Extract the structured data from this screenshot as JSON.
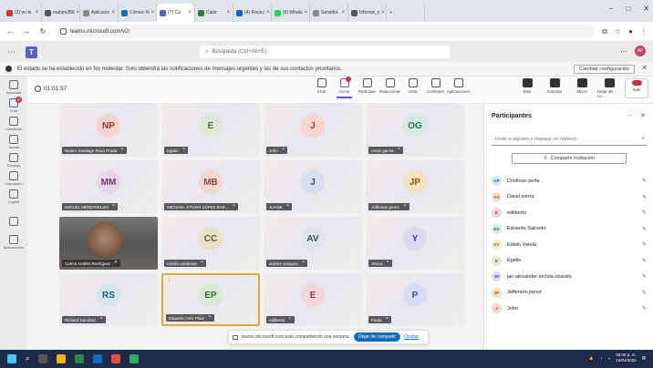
{
  "browser": {
    "tabs": [
      {
        "label": "(2) no le",
        "color": "#c23b22"
      },
      {
        "label": "mafam286",
        "color": "#555555"
      },
      {
        "label": "Aplicacio",
        "color": "#888888"
      },
      {
        "label": "Correo: N",
        "color": "#0f6cbd"
      },
      {
        "label": "(7) Ca",
        "color": "#5b5fc7",
        "active": true
      },
      {
        "label": "Calor",
        "color": "#2e7d32"
      },
      {
        "label": "(4) Rounc",
        "color": "#1565c0"
      },
      {
        "label": "(6) Whats",
        "color": "#25d366"
      },
      {
        "label": "Servidor",
        "color": "#888888"
      },
      {
        "label": "Informe_c",
        "color": "#555555"
      }
    ],
    "url": "teams.microsoft.com/v2/",
    "window_controls": [
      "−",
      "□",
      "✕"
    ]
  },
  "teams": {
    "search_placeholder": "Búsqueda (Ctrl+Alt+E)",
    "user_initials": "AF"
  },
  "banner": {
    "text": "El estado se ha establecido en No molestar. Solo obtendrá las notificaciones de mensajes urgentes y las de sus contactos prioritarios.",
    "button": "Cambiar configuración"
  },
  "rail": [
    {
      "label": "Actividad",
      "icon": "bell-icon"
    },
    {
      "label": "Chat",
      "icon": "chat-icon",
      "badge": "8",
      "active": true
    },
    {
      "label": "Llamadas",
      "icon": "phone-icon"
    },
    {
      "label": "Tareas",
      "icon": "tasks-icon"
    },
    {
      "label": "Equipos",
      "icon": "teams-icon"
    },
    {
      "label": "Calendario",
      "icon": "calendar-icon"
    },
    {
      "label": "Copilot",
      "icon": "copilot-icon"
    },
    {
      "label": "…",
      "icon": "more-icon"
    },
    {
      "label": "Aplicaciones",
      "icon": "apps-icon"
    }
  ],
  "meeting": {
    "timer": "01:01:57",
    "tools": [
      {
        "label": "Chat",
        "icon": "chat-icon"
      },
      {
        "label": "Gente",
        "icon": "people-icon",
        "active": true,
        "badge": true
      },
      {
        "label": "Participar",
        "icon": "raise-hand-icon"
      },
      {
        "label": "Reaccionar",
        "icon": "reaction-icon"
      },
      {
        "label": "Vista",
        "icon": "view-icon"
      },
      {
        "label": "Controles",
        "icon": "controls-icon"
      },
      {
        "label": "Aplicaciones",
        "icon": "apps-icon"
      }
    ],
    "tools2": [
      {
        "label": "Más",
        "icon": "more-icon"
      },
      {
        "label": "Cámara",
        "icon": "camera-off-icon"
      },
      {
        "label": "Micro",
        "icon": "mic-icon"
      },
      {
        "label": "Dejar de co...",
        "icon": "share-stop-icon"
      },
      {
        "label": "Salir",
        "icon": "leave-icon"
      }
    ]
  },
  "tiles": [
    {
      "initials": "NP",
      "name": "Nestor Santiago Rozo Prada",
      "color": "#f3d3cf",
      "fg": "#8b3a32"
    },
    {
      "initials": "E",
      "name": "Egidio",
      "color": "#dfe9d6",
      "fg": "#4a6b3a"
    },
    {
      "initials": "J",
      "name": "John",
      "color": "#f6d5cf",
      "fg": "#9b3d2f"
    },
    {
      "initials": "OG",
      "name": "oscar garcia",
      "color": "#d4ece4",
      "fg": "#2f6b58"
    },
    {
      "initials": "MM",
      "name": "MIGUEL MENDIVELSO",
      "color": "#ead6ea",
      "fg": "#6f3a6f"
    },
    {
      "initials": "MB",
      "name": "MICHAEL STIVEN LOPEZ BAR...",
      "color": "#f0d9d3",
      "fg": "#8a4a3a"
    },
    {
      "initials": "J",
      "name": "JUANK",
      "color": "#d9dff0",
      "fg": "#3a4a7a"
    },
    {
      "initials": "JP",
      "name": "Jefferson perez",
      "color": "#f3e2c4",
      "fg": "#8a5a1a"
    },
    {
      "initials": "",
      "name": "Carlos Andrés Rodríguez",
      "video": true
    },
    {
      "initials": "CC",
      "name": "camilo cardenas",
      "color": "#e6e2c8",
      "fg": "#6b5e2a"
    },
    {
      "initials": "AV",
      "name": "andres vasquez",
      "color": "#dfe4ea",
      "fg": "#3d4a5a"
    },
    {
      "initials": "Y",
      "name": "Yesca",
      "color": "#dcd8f0",
      "fg": "#4a3f8a"
    },
    {
      "initials": "RS",
      "name": "Richard Sanchez",
      "color": "#d2e6ec",
      "fg": "#2f5c6b"
    },
    {
      "initials": "EP",
      "name": "Eduardo Ortiz Páez",
      "color": "#d7ead4",
      "fg": "#3a6b33",
      "highlight": true,
      "reaction": "1"
    },
    {
      "initials": "E",
      "name": "edilberto",
      "color": "#f3d6dc",
      "fg": "#8a3a4a"
    },
    {
      "initials": "P",
      "name": "Paula",
      "color": "#d6dcf3",
      "fg": "#3a4a8a"
    }
  ],
  "share_bar": {
    "text": "teams.microsoft.com está compartiendo una ventana.",
    "stop": "Dejar de compartir",
    "hide": "Ocultar"
  },
  "panel": {
    "title": "Participantes",
    "invite_placeholder": "Invite a alguien o marque un número",
    "share_invite": "Compartir invitación",
    "participants": [
      {
        "initials": "CP",
        "name": "Cristhian peña",
        "color": "#d6e8f3",
        "fg": "#2a5a7a"
      },
      {
        "initials": "DS",
        "name": "David sierra",
        "color": "#f3e2d3",
        "fg": "#8a5a2a"
      },
      {
        "initials": "E",
        "name": "edilberto",
        "color": "#f3d6dc",
        "fg": "#8a3a4a"
      },
      {
        "initials": "ES",
        "name": "Eduardo Salcedo",
        "color": "#d6ece2",
        "fg": "#2f6b4a"
      },
      {
        "initials": "EV",
        "name": "Edwin Varela",
        "color": "#f3ecd3",
        "fg": "#7a6a2a"
      },
      {
        "initials": "E",
        "name": "Egidio",
        "color": "#dfe9d6",
        "fg": "#4a6b3a"
      },
      {
        "initials": "JO",
        "name": "jair alexander archila obando",
        "color": "#e2dcf0",
        "fg": "#4a3a7a"
      },
      {
        "initials": "JP",
        "name": "Jefferson perez",
        "color": "#f3e2c4",
        "fg": "#8a5a1a"
      },
      {
        "initials": "J",
        "name": "John",
        "color": "#f6d5cf",
        "fg": "#9b3d2f"
      }
    ]
  },
  "taskbar": {
    "time": "08:40 p. m.",
    "date": "16/04/2026"
  }
}
